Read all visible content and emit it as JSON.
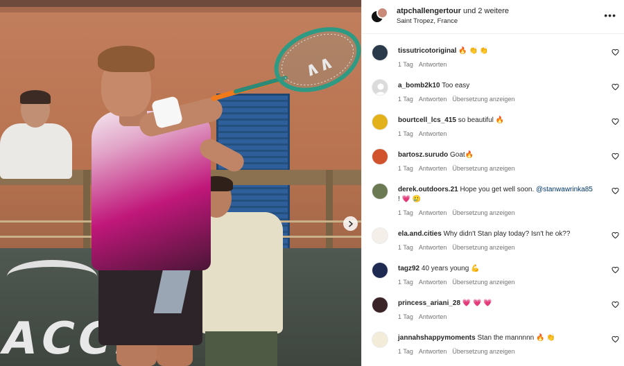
{
  "post": {
    "author": "atpchallengertour",
    "coauthors_suffix": "und 2 weitere",
    "location": "Saint Tropez, France",
    "more_icon": "more-horizontal-icon",
    "banner_text": "ACCM"
  },
  "comments": [
    {
      "user": "tissutricotoriginal",
      "text": "🔥 👏 👏",
      "time": "1 Tag",
      "reply": "Antworten",
      "translate": "",
      "avatar_color": "#2b3a4a"
    },
    {
      "user": "a_bomb2k10",
      "text": "Too easy",
      "time": "1 Tag",
      "reply": "Antworten",
      "translate": "Übersetzung anzeigen",
      "avatar_color": "#dbdbdb"
    },
    {
      "user": "bourtcell_lcs_415",
      "text": "so beautiful 🔥",
      "time": "1 Tag",
      "reply": "Antworten",
      "translate": "",
      "avatar_color": "#e3b11a"
    },
    {
      "user": "bartosz.surudo",
      "text": "Goat🔥",
      "time": "1 Tag",
      "reply": "Antworten",
      "translate": "Übersetzung anzeigen",
      "avatar_color": "#d1532e"
    },
    {
      "user": "derek.outdoors.21",
      "text": "Hope you get well soon.",
      "mention": "@stanwawrinka85",
      "text2": "! 💗 🥲",
      "time": "1 Tag",
      "reply": "Antworten",
      "translate": "Übersetzung anzeigen",
      "avatar_color": "#6b7a52"
    },
    {
      "user": "ela.and.cities",
      "text": "Why didn't Stan play today? Isn't he ok??",
      "time": "1 Tag",
      "reply": "Antworten",
      "translate": "Übersetzung anzeigen",
      "avatar_color": "#f4efe9"
    },
    {
      "user": "tagz92",
      "text": "40 years young 💪",
      "time": "1 Tag",
      "reply": "Antworten",
      "translate": "Übersetzung anzeigen",
      "avatar_color": "#1e2a52"
    },
    {
      "user": "princess_ariani_28",
      "text": "💗 💗 💗",
      "time": "1 Tag",
      "reply": "Antworten",
      "translate": "",
      "avatar_color": "#3a2428"
    },
    {
      "user": "jannahshappymoments",
      "text": "Stan the mannnnn 🔥 👏",
      "time": "1 Tag",
      "reply": "Antworten",
      "translate": "Übersetzung anzeigen",
      "avatar_color": "#f3ecd8"
    }
  ],
  "icons": {
    "like": "heart-outline-icon",
    "next": "chevron-right-icon"
  }
}
